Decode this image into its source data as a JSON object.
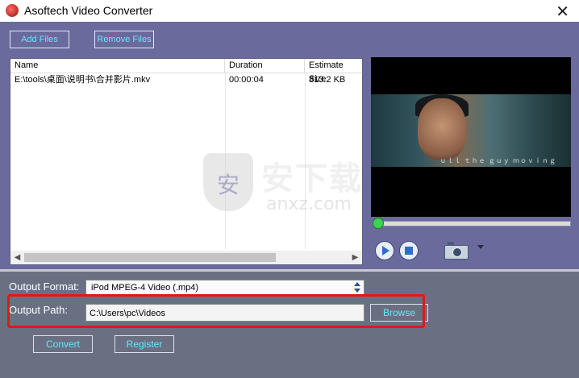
{
  "window": {
    "title": "Asoftech Video Converter",
    "close_symbol": "✕"
  },
  "toolbar": {
    "add_files_label": "Add Files",
    "remove_files_label": "Remove Files"
  },
  "file_list": {
    "columns": [
      "Name",
      "Duration",
      "Estimate Size"
    ],
    "rows": [
      {
        "name": "E:\\tools\\桌面\\说明书\\合并影片.mkv",
        "duration": "00:00:04",
        "size": "813.2 KB"
      }
    ]
  },
  "preview": {
    "subtitle_text": "ｕｌｌ ｔｈｅ ｇｕｙ ｍｏｖｉｎｇ"
  },
  "player": {
    "play_icon": "play-icon",
    "stop_icon": "stop-icon",
    "snapshot_icon": "camera-icon",
    "seek_position": 0
  },
  "output": {
    "format_label": "Output Format:",
    "format_value": "iPod MPEG-4 Video (.mp4)",
    "path_label": "Output Path:",
    "path_value": "C:\\Users\\pc\\Videos",
    "browse_label": "Browse"
  },
  "actions": {
    "convert_label": "Convert",
    "register_label": "Register"
  },
  "watermark": {
    "cn_text": "安下载",
    "en_text": "anxz.com",
    "shield_text": "安"
  },
  "colors": {
    "accent_text": "#66e6ff",
    "main_panel": "#6a6a9c",
    "bottom_panel": "#6a7082",
    "highlight": "#e01818"
  }
}
